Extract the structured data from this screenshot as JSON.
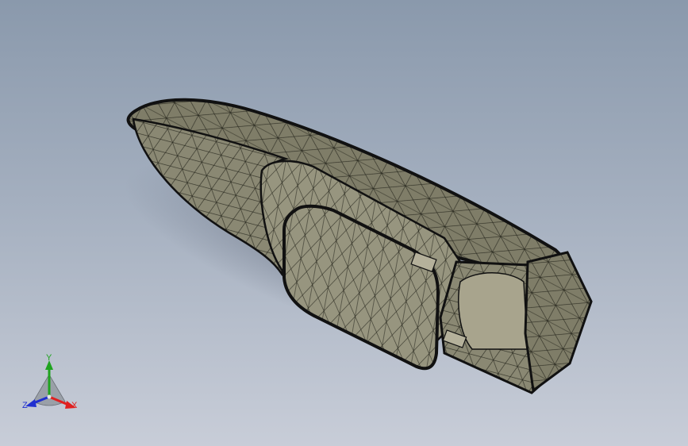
{
  "viewport": {
    "background_top": "#8a99ac",
    "background_bottom": "#c8cdd8",
    "model_fill": "#7d7b66",
    "edge_color": "#1a1a14"
  },
  "triad": {
    "x_label": "X",
    "y_label": "Y",
    "z_label": "Z",
    "x_color": "#e02020",
    "y_color": "#1fa31f",
    "z_color": "#2030d0"
  }
}
